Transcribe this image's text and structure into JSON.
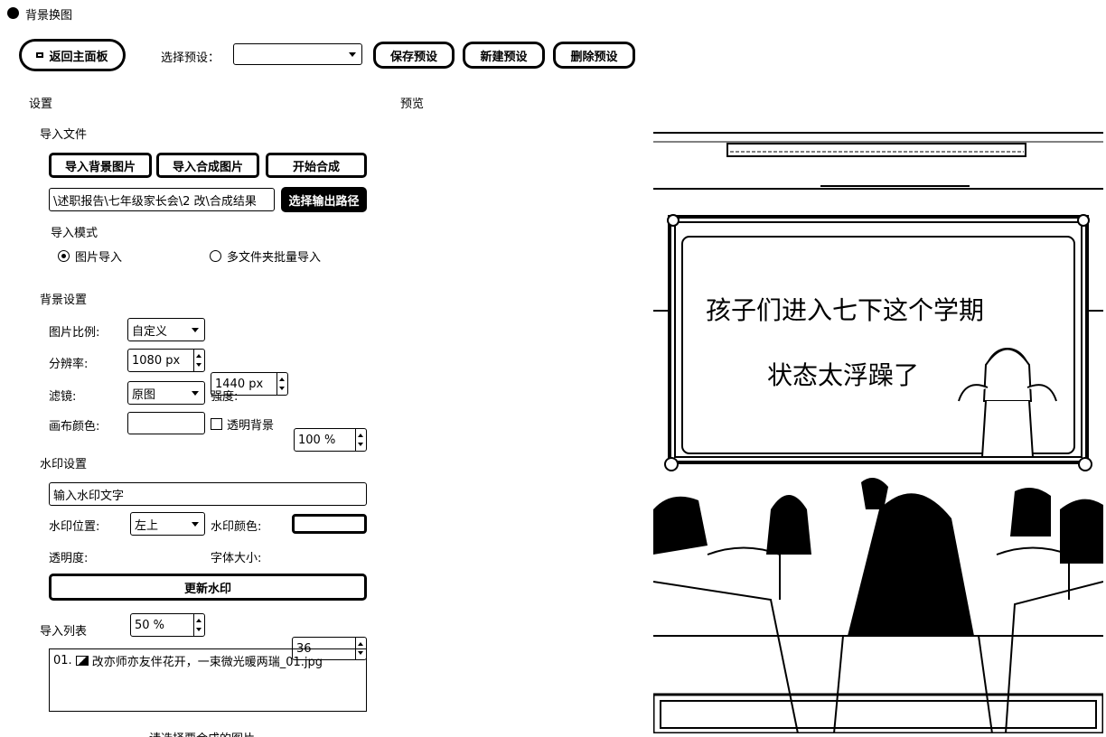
{
  "window": {
    "title": "背景换图"
  },
  "toolbar": {
    "back_label": "返回主面板",
    "preset_label": "选择预设：",
    "preset_value": "",
    "save_label": "保存预设",
    "new_label": "新建预设",
    "delete_label": "删除预设"
  },
  "settings": {
    "title": "设置",
    "import_files": {
      "title": "导入文件",
      "import_bg_label": "导入背景图片",
      "import_comp_label": "导入合成图片",
      "start_label": "开始合成",
      "output_path": "\\述职报告\\七年级家长会\\2 改\\合成结果",
      "choose_output_label": "选择输出路径"
    },
    "import_mode": {
      "title": "导入模式",
      "options": [
        "图片导入",
        "多文件夹批量导入"
      ],
      "selected": "图片导入"
    },
    "background": {
      "title": "背景设置",
      "ratio_label": "图片比例:",
      "ratio_value": "自定义",
      "resolution_label": "分辨率:",
      "width_value": "1080 px",
      "height_value": "1440 px",
      "filter_label": "滤镜:",
      "filter_value": "原图",
      "strength_label": "强度:",
      "strength_value": "100 %",
      "canvas_color_label": "画布颜色:",
      "transparent_label": "透明背景"
    },
    "watermark": {
      "title": "水印设置",
      "text_placeholder": "输入水印文字",
      "position_label": "水印位置:",
      "position_value": "左上",
      "color_label": "水印颜色:",
      "opacity_label": "透明度:",
      "opacity_value": "50 %",
      "font_size_label": "字体大小:",
      "font_size_value": "36",
      "update_label": "更新水印"
    },
    "import_list": {
      "title": "导入列表",
      "items": [
        {
          "index": "01.",
          "name": "改亦师亦友伴花开，一束微光暖两瑞_01.jpg"
        }
      ]
    },
    "status": "请选择要合成的图片"
  },
  "preview": {
    "title": "预览",
    "line1": "孩子们进入七下这个学期",
    "line2": "状态太浮躁了"
  }
}
